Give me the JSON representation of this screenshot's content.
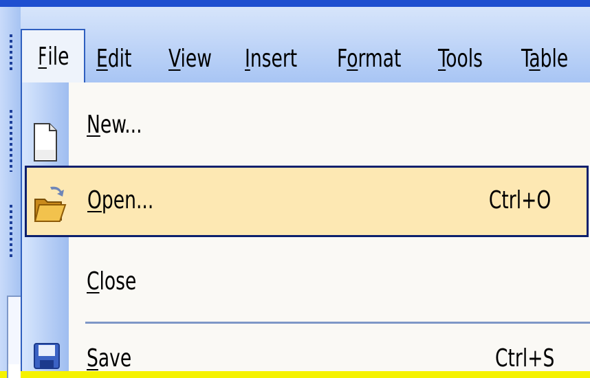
{
  "menubar": {
    "items": [
      {
        "label": "File",
        "underline": "F",
        "active": true
      },
      {
        "label": "Edit",
        "underline": "E"
      },
      {
        "label": "View",
        "underline": "V"
      },
      {
        "label": "Insert",
        "underline": "I"
      },
      {
        "label": "Format",
        "underline": "o"
      },
      {
        "label": "Tools",
        "underline": "T"
      },
      {
        "label": "Table",
        "underline": "a"
      }
    ]
  },
  "file_menu": {
    "items": [
      {
        "label": "New...",
        "icon": "new-document-icon",
        "shortcut": ""
      },
      {
        "label": "Open...",
        "icon": "open-folder-icon",
        "shortcut": "Ctrl+O",
        "highlighted": true
      },
      {
        "label": "Close",
        "icon": "",
        "shortcut": ""
      },
      {
        "label": "Save",
        "icon": "save-disk-icon",
        "shortcut": "Ctrl+S"
      }
    ]
  },
  "colors": {
    "highlight": "#fde8b3",
    "highlight_border": "#0b1f6d",
    "menubar": "#c6daf8",
    "title_bar": "#1f4fd0",
    "background": "#f5f200"
  }
}
